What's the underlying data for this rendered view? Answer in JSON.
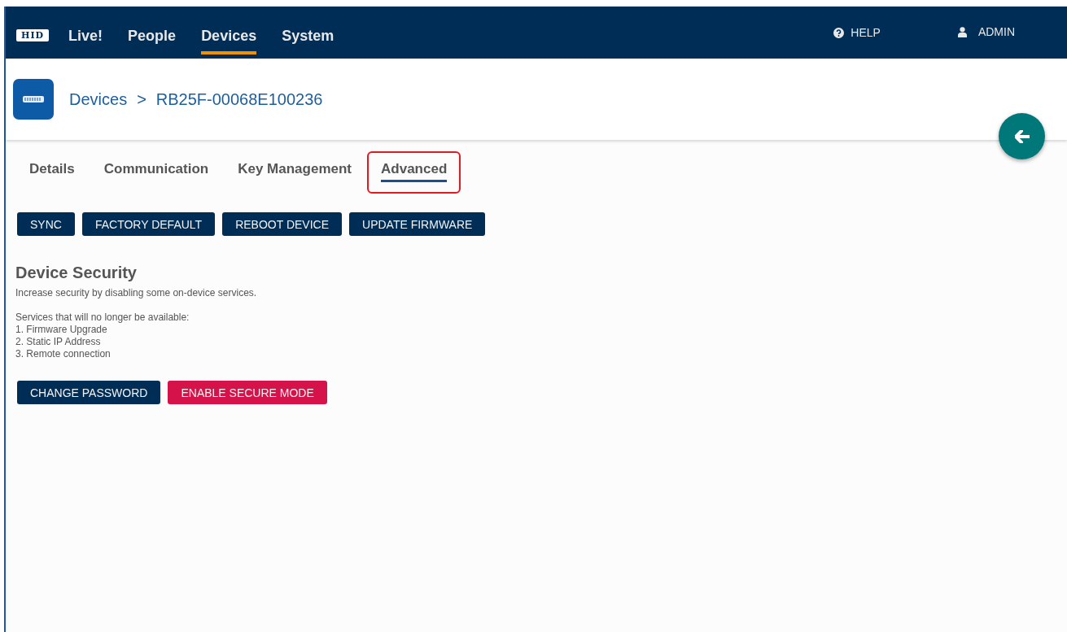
{
  "nav": {
    "logo": "HID",
    "items": [
      {
        "label": "Live!",
        "selected": false
      },
      {
        "label": "People",
        "selected": false
      },
      {
        "label": "Devices",
        "selected": true
      },
      {
        "label": "System",
        "selected": false
      }
    ],
    "help": "HELP",
    "user": "ADMIN"
  },
  "breadcrumb": {
    "parent": "Devices",
    "separator": ">",
    "current": "RB25F-00068E100236"
  },
  "tabs": [
    {
      "label": "Details",
      "selected": false,
      "highlighted": false
    },
    {
      "label": "Communication",
      "selected": false,
      "highlighted": false
    },
    {
      "label": "Key Management",
      "selected": false,
      "highlighted": false
    },
    {
      "label": "Advanced",
      "selected": true,
      "highlighted": true
    }
  ],
  "actions": [
    "SYNC",
    "FACTORY DEFAULT",
    "REBOOT DEVICE",
    "UPDATE FIRMWARE"
  ],
  "security": {
    "title": "Device Security",
    "intro": "Increase security by disabling some on-device services.",
    "lines": [
      "Services that will no longer be available:",
      "1. Firmware Upgrade",
      "2. Static IP Address",
      "3. Remote connection"
    ],
    "buttons": [
      {
        "label": "CHANGE PASSWORD",
        "kind": "primary"
      },
      {
        "label": "ENABLE SECURE MODE",
        "kind": "danger"
      }
    ]
  }
}
